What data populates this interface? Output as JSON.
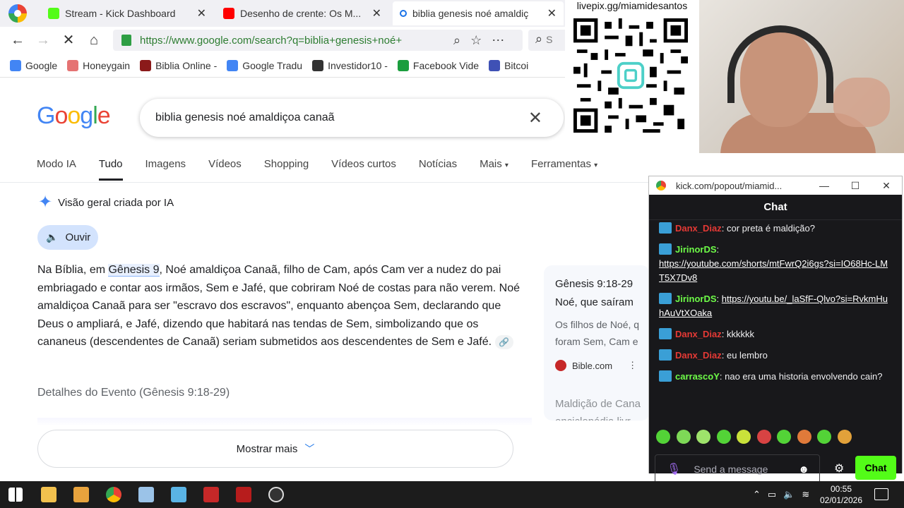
{
  "browser": {
    "tabs": [
      {
        "title": "Stream - Kick Dashboard",
        "icon": "kick-icon"
      },
      {
        "title": "Desenho de crente: Os M...",
        "icon": "youtube-icon"
      },
      {
        "title": "biblia genesis noé amaldiç",
        "icon": "google-icon"
      }
    ],
    "url": "https://www.google.com/search?q=biblia+genesis+noé+",
    "search_mini": "S",
    "bookmarks": [
      "Google",
      "Honeygain",
      "Biblia Online -",
      "Google Tradu",
      "Investidor10 -",
      "Facebook Vide",
      "Bitcoi"
    ]
  },
  "google": {
    "query": "biblia genesis noé amaldiçoa canaã",
    "tabs": [
      "Modo IA",
      "Tudo",
      "Imagens",
      "Vídeos",
      "Shopping",
      "Vídeos curtos",
      "Notícias",
      "Mais",
      "Ferramentas"
    ],
    "ai_heading": "Visão geral criada por IA",
    "listen_label": "Ouvir",
    "ai_text_pre": "Na Bíblia, em ",
    "ai_text_highlight": "Gênesis 9",
    "ai_text_post": ", Noé amaldiçoa Canaã, filho de Cam, após Cam ver a nudez do pai embriagado e contar aos irmãos, Sem e Jafé, que cobriram Noé de costas para não verem. Noé amaldiçoa Canaã para ser \"escravo dos escravos\", enquanto abençoa Sem, declarando que Deus o ampliará, e Jafé, dizendo que habitará nas tendas de Sem, simbolizando que os cananeus (descendentes de Canaã) seriam submetidos aos descendentes de Sem e Jafé.",
    "details_heading": "Detalhes do Evento (Gênesis 9:18-29)",
    "more_label": "Mostrar mais",
    "side_card": {
      "title_line1": "Gênesis 9:18-29",
      "title_line2": "Noé, que saíram",
      "snippet_line1": "Os filhos de Noé, q",
      "snippet_line2": "foram Sem, Cam e",
      "source": "Bible.com",
      "next_line1": "Maldição de Cana",
      "next_line2": "enciclopédia livr"
    }
  },
  "stream": {
    "qr_text": "livepix.gg/miamidesantos"
  },
  "chat": {
    "window_url": "kick.com/popout/miamid...",
    "header": "Chat",
    "messages": [
      {
        "user": "Danx_Diaz",
        "color": "red",
        "text": "cor preta é maldição?"
      },
      {
        "user": "JirinorDS",
        "color": "green",
        "text": "",
        "link": "https://youtube.com/shorts/mtFwrQ2i6gs?si=IO68Hc-LMT5X7Dv8"
      },
      {
        "user": "JirinorDS",
        "color": "green",
        "text": "",
        "link": "https://youtu.be/_laSfF-Qlvo?si=RvkmHuhAuVtXOaka"
      },
      {
        "user": "Danx_Diaz",
        "color": "red",
        "text": "kkkkkk"
      },
      {
        "user": "Danx_Diaz",
        "color": "red",
        "text": "eu lembro"
      },
      {
        "user": "carrascoY",
        "color": "green",
        "text": "nao era uma historia envolvendo cain?"
      }
    ],
    "input_placeholder": "Send a message",
    "send_label": "Chat"
  },
  "taskbar": {
    "time": "00:55",
    "date": "02/01/2026"
  },
  "colors": {
    "kick_green": "#53fc18",
    "chat_bg": "#18181b",
    "google_blue": "#4285f4"
  }
}
